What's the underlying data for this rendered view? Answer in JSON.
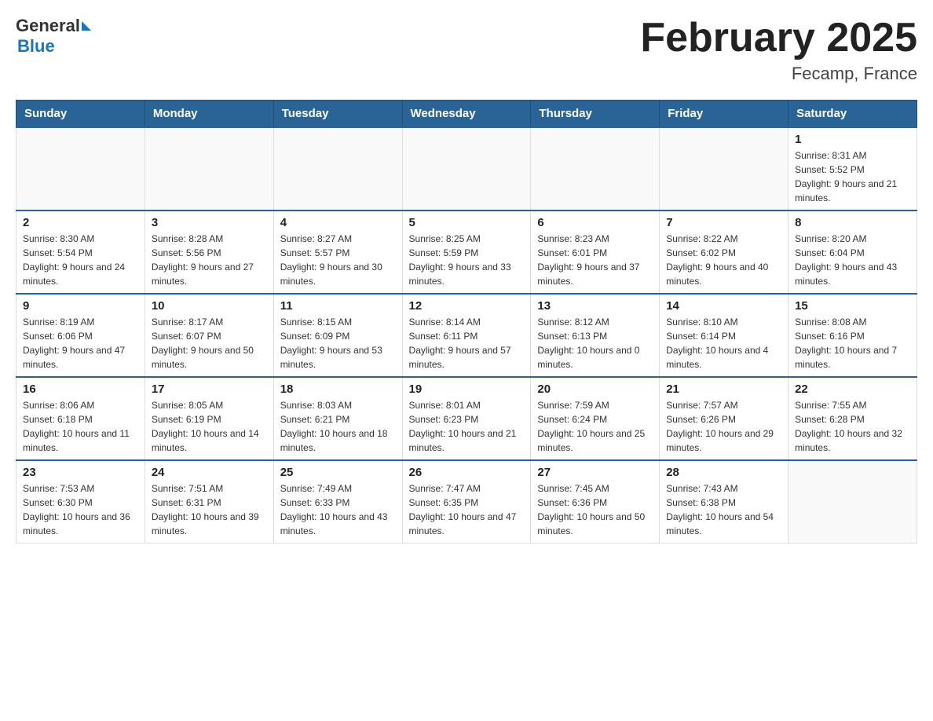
{
  "header": {
    "logo_general": "General",
    "logo_blue": "Blue",
    "title": "February 2025",
    "subtitle": "Fecamp, France"
  },
  "days_of_week": [
    "Sunday",
    "Monday",
    "Tuesday",
    "Wednesday",
    "Thursday",
    "Friday",
    "Saturday"
  ],
  "weeks": [
    [
      {
        "day": "",
        "info": ""
      },
      {
        "day": "",
        "info": ""
      },
      {
        "day": "",
        "info": ""
      },
      {
        "day": "",
        "info": ""
      },
      {
        "day": "",
        "info": ""
      },
      {
        "day": "",
        "info": ""
      },
      {
        "day": "1",
        "info": "Sunrise: 8:31 AM\nSunset: 5:52 PM\nDaylight: 9 hours and 21 minutes."
      }
    ],
    [
      {
        "day": "2",
        "info": "Sunrise: 8:30 AM\nSunset: 5:54 PM\nDaylight: 9 hours and 24 minutes."
      },
      {
        "day": "3",
        "info": "Sunrise: 8:28 AM\nSunset: 5:56 PM\nDaylight: 9 hours and 27 minutes."
      },
      {
        "day": "4",
        "info": "Sunrise: 8:27 AM\nSunset: 5:57 PM\nDaylight: 9 hours and 30 minutes."
      },
      {
        "day": "5",
        "info": "Sunrise: 8:25 AM\nSunset: 5:59 PM\nDaylight: 9 hours and 33 minutes."
      },
      {
        "day": "6",
        "info": "Sunrise: 8:23 AM\nSunset: 6:01 PM\nDaylight: 9 hours and 37 minutes."
      },
      {
        "day": "7",
        "info": "Sunrise: 8:22 AM\nSunset: 6:02 PM\nDaylight: 9 hours and 40 minutes."
      },
      {
        "day": "8",
        "info": "Sunrise: 8:20 AM\nSunset: 6:04 PM\nDaylight: 9 hours and 43 minutes."
      }
    ],
    [
      {
        "day": "9",
        "info": "Sunrise: 8:19 AM\nSunset: 6:06 PM\nDaylight: 9 hours and 47 minutes."
      },
      {
        "day": "10",
        "info": "Sunrise: 8:17 AM\nSunset: 6:07 PM\nDaylight: 9 hours and 50 minutes."
      },
      {
        "day": "11",
        "info": "Sunrise: 8:15 AM\nSunset: 6:09 PM\nDaylight: 9 hours and 53 minutes."
      },
      {
        "day": "12",
        "info": "Sunrise: 8:14 AM\nSunset: 6:11 PM\nDaylight: 9 hours and 57 minutes."
      },
      {
        "day": "13",
        "info": "Sunrise: 8:12 AM\nSunset: 6:13 PM\nDaylight: 10 hours and 0 minutes."
      },
      {
        "day": "14",
        "info": "Sunrise: 8:10 AM\nSunset: 6:14 PM\nDaylight: 10 hours and 4 minutes."
      },
      {
        "day": "15",
        "info": "Sunrise: 8:08 AM\nSunset: 6:16 PM\nDaylight: 10 hours and 7 minutes."
      }
    ],
    [
      {
        "day": "16",
        "info": "Sunrise: 8:06 AM\nSunset: 6:18 PM\nDaylight: 10 hours and 11 minutes."
      },
      {
        "day": "17",
        "info": "Sunrise: 8:05 AM\nSunset: 6:19 PM\nDaylight: 10 hours and 14 minutes."
      },
      {
        "day": "18",
        "info": "Sunrise: 8:03 AM\nSunset: 6:21 PM\nDaylight: 10 hours and 18 minutes."
      },
      {
        "day": "19",
        "info": "Sunrise: 8:01 AM\nSunset: 6:23 PM\nDaylight: 10 hours and 21 minutes."
      },
      {
        "day": "20",
        "info": "Sunrise: 7:59 AM\nSunset: 6:24 PM\nDaylight: 10 hours and 25 minutes."
      },
      {
        "day": "21",
        "info": "Sunrise: 7:57 AM\nSunset: 6:26 PM\nDaylight: 10 hours and 29 minutes."
      },
      {
        "day": "22",
        "info": "Sunrise: 7:55 AM\nSunset: 6:28 PM\nDaylight: 10 hours and 32 minutes."
      }
    ],
    [
      {
        "day": "23",
        "info": "Sunrise: 7:53 AM\nSunset: 6:30 PM\nDaylight: 10 hours and 36 minutes."
      },
      {
        "day": "24",
        "info": "Sunrise: 7:51 AM\nSunset: 6:31 PM\nDaylight: 10 hours and 39 minutes."
      },
      {
        "day": "25",
        "info": "Sunrise: 7:49 AM\nSunset: 6:33 PM\nDaylight: 10 hours and 43 minutes."
      },
      {
        "day": "26",
        "info": "Sunrise: 7:47 AM\nSunset: 6:35 PM\nDaylight: 10 hours and 47 minutes."
      },
      {
        "day": "27",
        "info": "Sunrise: 7:45 AM\nSunset: 6:36 PM\nDaylight: 10 hours and 50 minutes."
      },
      {
        "day": "28",
        "info": "Sunrise: 7:43 AM\nSunset: 6:38 PM\nDaylight: 10 hours and 54 minutes."
      },
      {
        "day": "",
        "info": ""
      }
    ]
  ]
}
